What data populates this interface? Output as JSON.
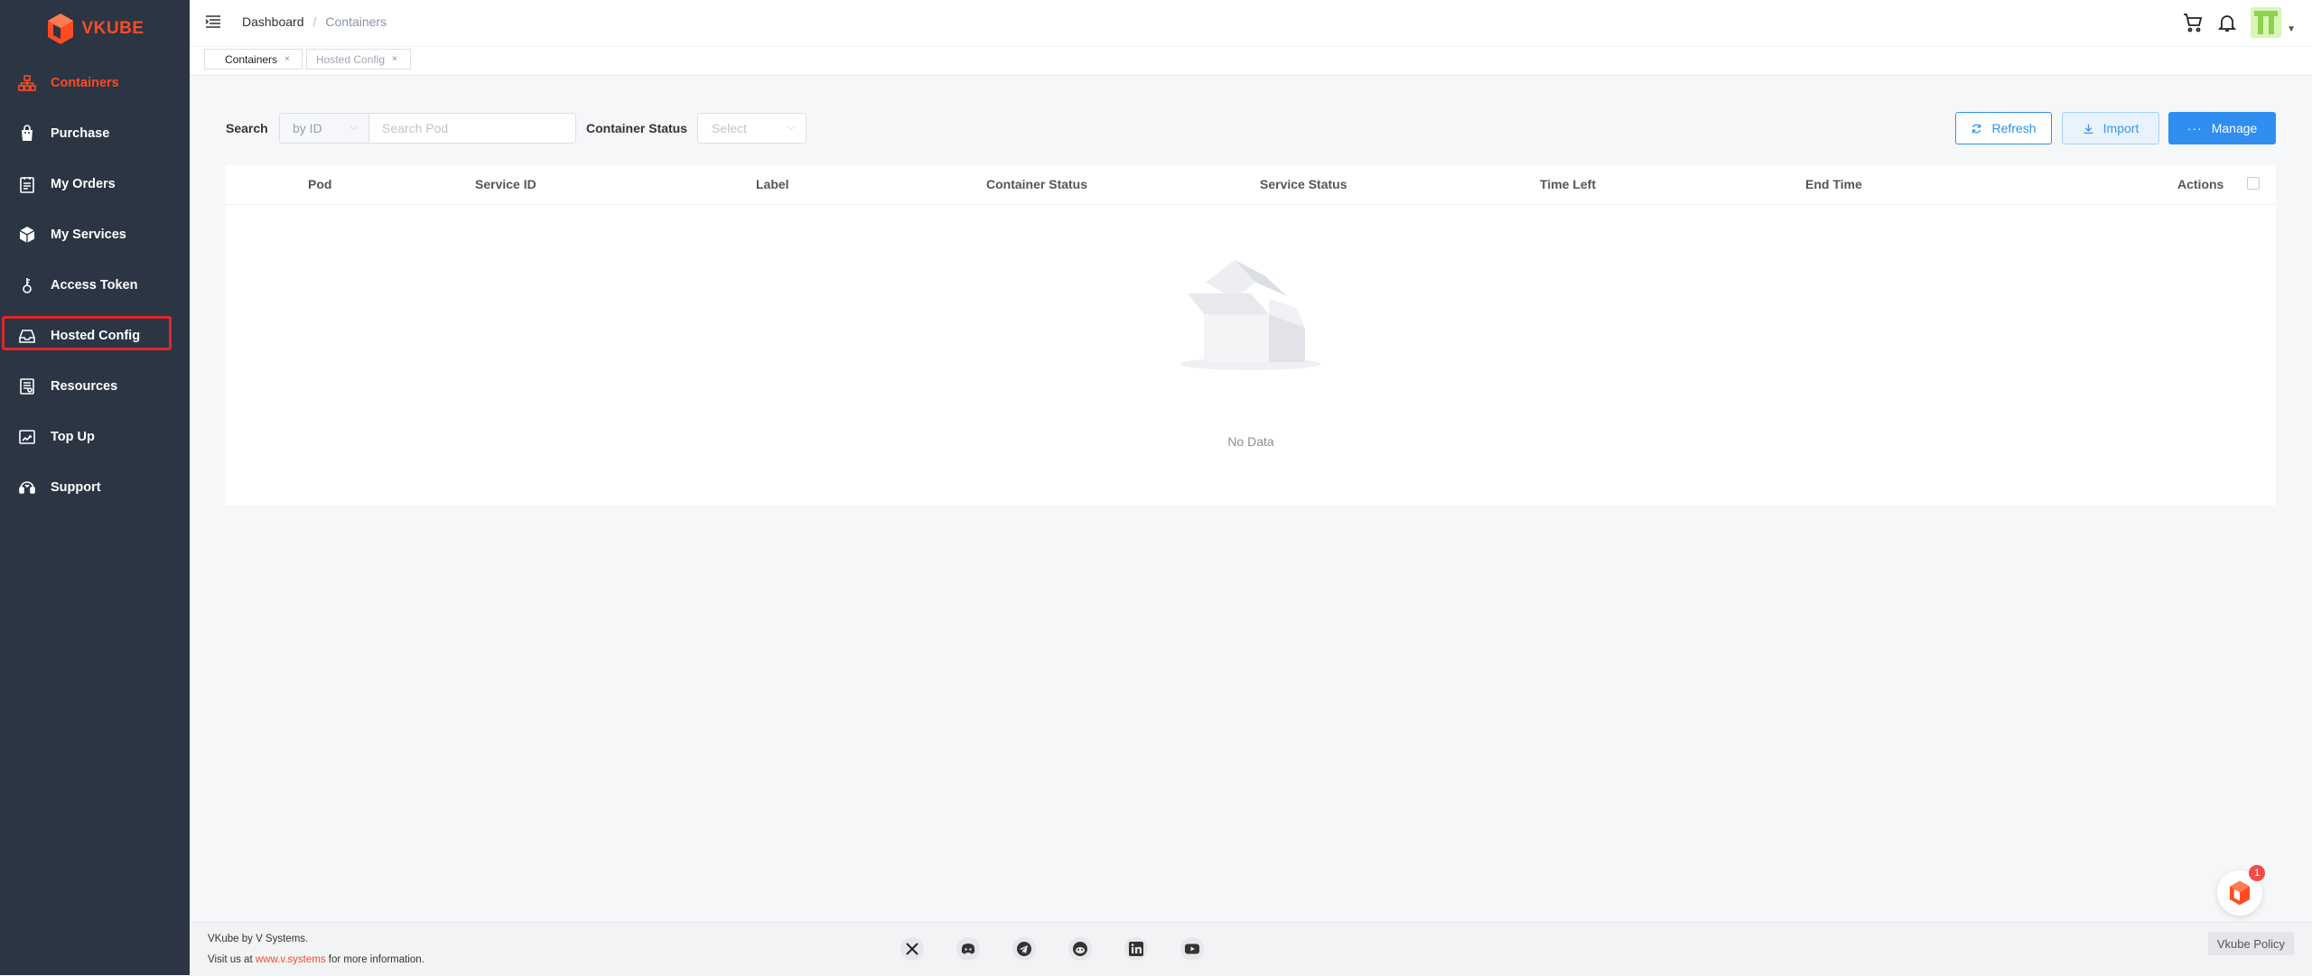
{
  "brand": {
    "name": "VKUBE"
  },
  "sidebar": {
    "items": [
      {
        "label": "Containers",
        "icon": "sitemap-icon",
        "active": true
      },
      {
        "label": "Purchase",
        "icon": "shopping-bag-icon"
      },
      {
        "label": "My Orders",
        "icon": "clipboard-icon"
      },
      {
        "label": "My Services",
        "icon": "cube-icon"
      },
      {
        "label": "Access Token",
        "icon": "key-icon"
      },
      {
        "label": "Hosted Config",
        "icon": "inbox-icon",
        "highlighted": true
      },
      {
        "label": "Resources",
        "icon": "document-icon"
      },
      {
        "label": "Top Up",
        "icon": "top-up-icon"
      },
      {
        "label": "Support",
        "icon": "headset-icon"
      }
    ]
  },
  "header": {
    "breadcrumb": {
      "home": "Dashboard",
      "separator": "/",
      "current": "Containers"
    }
  },
  "tabs": [
    {
      "label": "Containers",
      "close": "×"
    },
    {
      "label": "Hosted Config",
      "close": "×"
    }
  ],
  "toolbar": {
    "search_label": "Search",
    "search_by": "by ID",
    "search_placeholder": "Search Pod",
    "status_label": "Container Status",
    "status_placeholder": "Select",
    "refresh_label": "Refresh",
    "import_label": "Import",
    "manage_label": "Manage"
  },
  "table": {
    "columns": [
      "Pod",
      "Service ID",
      "Label",
      "Container Status",
      "Service Status",
      "Time Left",
      "End Time",
      "Actions"
    ],
    "empty_text": "No Data"
  },
  "footer": {
    "line1": "VKube by V Systems.",
    "line2_prefix": "Visit us at ",
    "line2_link": "www.v.systems",
    "line2_suffix": " for more information.",
    "social": [
      "x-icon",
      "discord-icon",
      "telegram-icon",
      "reddit-icon",
      "linkedin-icon",
      "youtube-icon"
    ],
    "policy": "Vkube Policy"
  },
  "chat": {
    "badge": "1"
  },
  "colors": {
    "accent": "#ff4b22",
    "primary": "#2f8ef0",
    "sidebar_bg": "#2b3544",
    "highlight_border": "#e1262a"
  }
}
